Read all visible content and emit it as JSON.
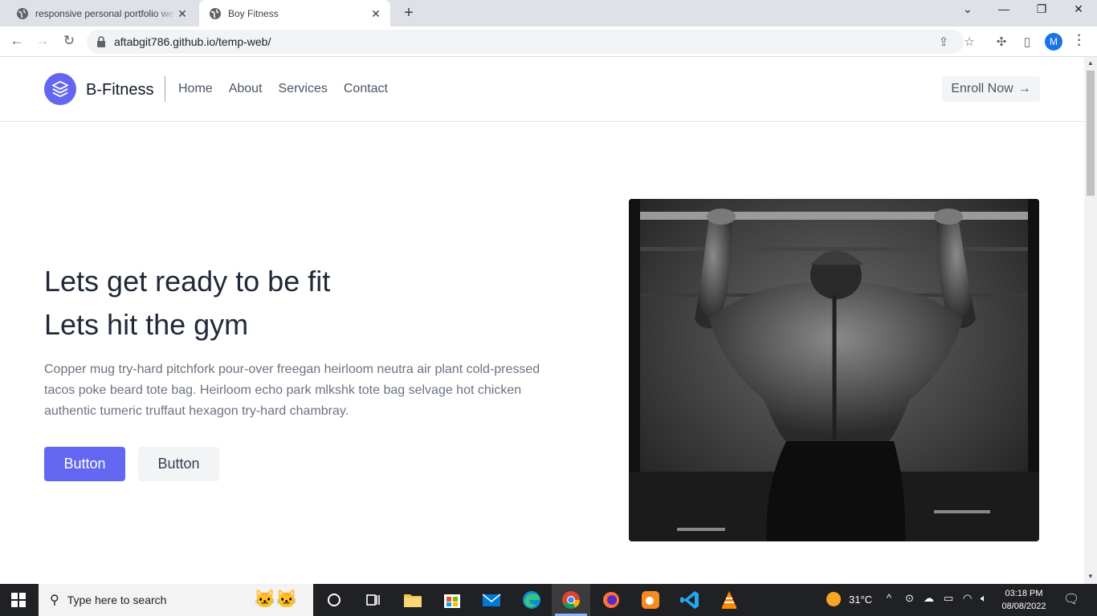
{
  "browser": {
    "tabs": [
      {
        "title": "responsive personal portfolio we",
        "active": false
      },
      {
        "title": "Boy Fitness",
        "active": true
      }
    ],
    "url": "aftabgit786.github.io/temp-web/",
    "profile_initial": "M"
  },
  "site": {
    "brand": "B-Fitness",
    "nav": [
      "Home",
      "About",
      "Services",
      "Contact"
    ],
    "enroll_label": "Enroll Now",
    "hero": {
      "heading_line1": "Lets get ready to be fit",
      "heading_line2": "Lets hit the gym",
      "paragraph": "Copper mug try-hard pitchfork pour-over freegan heirloom neutra air plant cold-pressed tacos poke beard tote bag. Heirloom echo park mlkshk tote bag selvage hot chicken authentic tumeric truffaut hexagon try-hard chambray.",
      "primary_button": "Button",
      "secondary_button": "Button"
    },
    "accent_color": "#6366f1"
  },
  "taskbar": {
    "search_placeholder": "Type here to search",
    "temperature": "31°C",
    "time": "03:18 PM",
    "date": "08/08/2022"
  }
}
